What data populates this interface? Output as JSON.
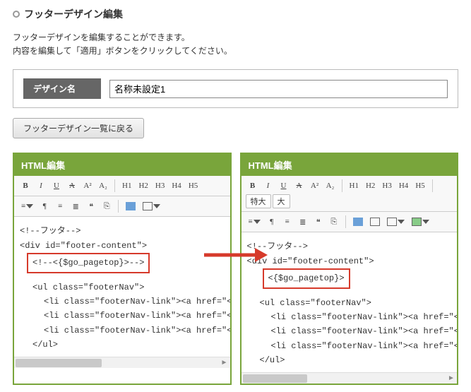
{
  "page": {
    "title": "フッターデザイン編集",
    "desc_line1": "フッターデザインを編集することができます。",
    "desc_line2": "内容を編集して「適用」ボタンをクリックしてください。"
  },
  "field": {
    "label": "デザイン名",
    "value": "名称未設定1"
  },
  "buttons": {
    "back": "フッターデザイン一覧に戻る"
  },
  "toolbar": {
    "bold": "B",
    "italic": "I",
    "underline": "U",
    "strike": "A",
    "sup": "A²",
    "sub": "A₂",
    "h1": "H1",
    "h2": "H2",
    "h3": "H3",
    "h4": "H4",
    "h5": "H5",
    "para": "¶",
    "ol": "≡",
    "ul": "≣",
    "quote": "❝",
    "link": "⎘",
    "size_xl": "特大",
    "size_l": "大"
  },
  "panel_left": {
    "title": "HTML編集",
    "code": {
      "l1": "<!--フッタ-->",
      "l2": "<div id=\"footer-content\">",
      "hl": "<!--<{$go_pagetop}>-->",
      "l4": "<ul class=\"footerNav\">",
      "l5": "<li class=\"footerNav-link\"><a href=\"<{$g",
      "l6": "<li class=\"footerNav-link\"><a href=\"<{$c",
      "l7": "<li class=\"footerNav-link\"><a href=\"<{$p",
      "l8": "</ul>"
    }
  },
  "panel_right": {
    "title": "HTML編集",
    "code": {
      "l1": "<!--フッタ-->",
      "l2": "<div id=\"footer-content\">",
      "hl": "<{$go_pagetop}>",
      "l4": "<ul class=\"footerNav\">",
      "l5": "<li class=\"footerNav-link\"><a href=\"<{$guide_url}>\"><span",
      "l6": "<li class=\"footerNav-link\"><a href=\"<{$contract_url}>\" targe",
      "l7": "<li class=\"footerNav-link\"><a href=\"<{$policy_url}>\"><span",
      "l8": "</ul>"
    }
  }
}
